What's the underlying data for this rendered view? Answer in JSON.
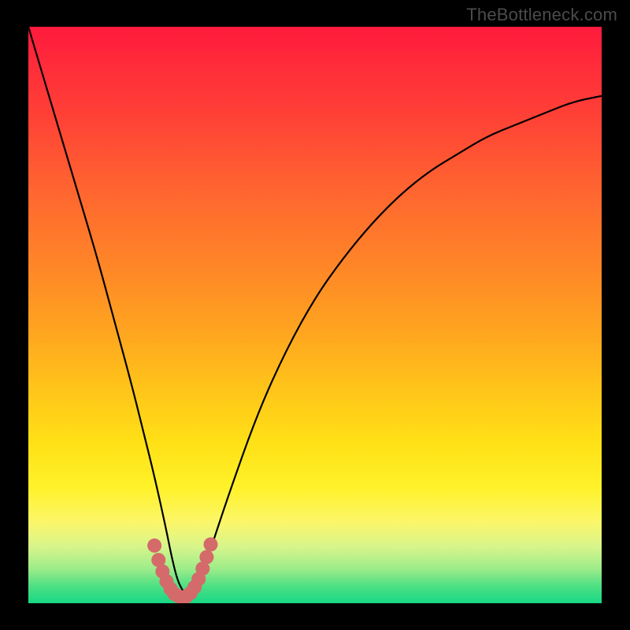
{
  "attribution": "TheBottleneck.com",
  "chart_data": {
    "type": "line",
    "title": "",
    "xlabel": "",
    "ylabel": "",
    "xlim": [
      0,
      100
    ],
    "ylim": [
      0,
      100
    ],
    "grid": false,
    "series": [
      {
        "name": "curve",
        "color": "#000000",
        "x": [
          0,
          3,
          6,
          9,
          12,
          15,
          18,
          20,
          22,
          24,
          25,
          26,
          27,
          28,
          29,
          30,
          32,
          35,
          40,
          45,
          50,
          55,
          60,
          65,
          70,
          75,
          80,
          85,
          90,
          95,
          100
        ],
        "values": [
          100,
          90,
          80,
          70,
          60,
          49,
          38,
          30,
          22,
          13,
          8,
          4,
          2,
          1,
          2,
          4,
          10,
          19,
          33,
          44,
          53,
          60,
          66,
          71,
          75,
          78,
          81,
          83,
          85,
          87,
          88
        ]
      },
      {
        "name": "marker-band",
        "color": "#d46a6a",
        "x": [
          22.0,
          22.7,
          23.4,
          24.1,
          24.8,
          25.5,
          26.2,
          26.9,
          27.6,
          28.3,
          29.0,
          29.7,
          30.4,
          31.1,
          31.8
        ],
        "values": [
          10.0,
          7.5,
          5.5,
          3.8,
          2.5,
          1.6,
          1.2,
          1.0,
          1.2,
          1.8,
          2.8,
          4.2,
          6.0,
          8.0,
          10.2
        ]
      }
    ]
  }
}
